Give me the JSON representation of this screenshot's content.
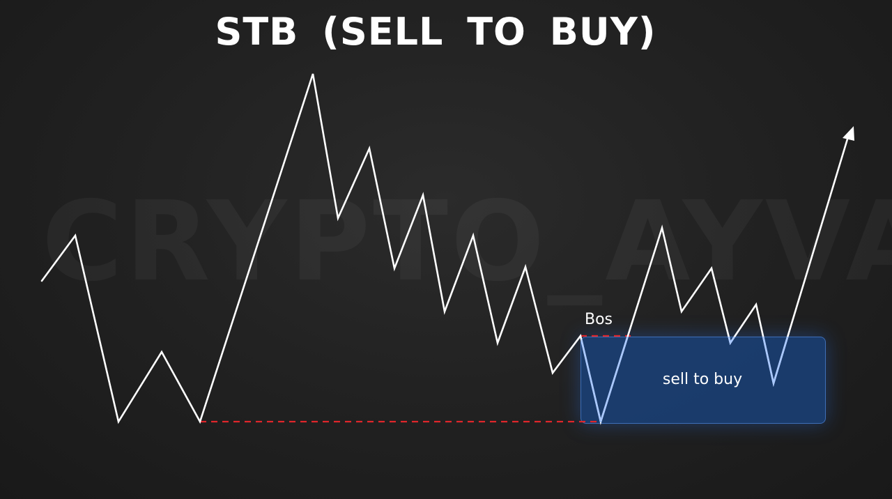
{
  "title": "STB (SELL TO BUY)",
  "watermark": "CRYPTO_AYVA",
  "labels": {
    "bos": "Bos",
    "zone": "sell to buy"
  },
  "colors": {
    "background": "#1f1f1f",
    "price_line": "#ffffff",
    "line_in_zone": "#a9c8ff",
    "dashed_level": "#e0262b",
    "zone_fill": "#1a4482",
    "zone_border": "#3f6fb8"
  },
  "icons": {
    "arrow_head": "arrow-up-right-icon"
  }
}
